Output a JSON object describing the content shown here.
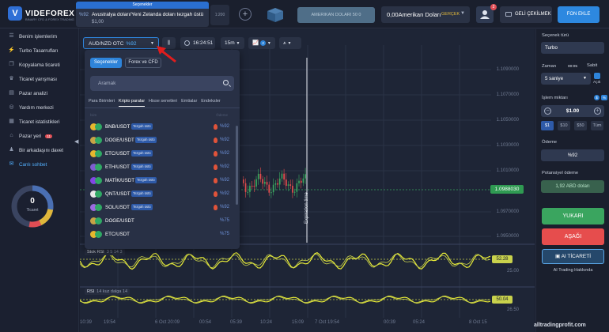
{
  "brand": {
    "name": "VIDEFOREX",
    "tagline": "BINARY CFD & FOREX TRADING"
  },
  "topbar": {
    "active_tab_header": "Seçenekler",
    "active_tab_pct": "%92",
    "active_tab_pair": "Avustralya doları/Yeni Zelanda doları tezgah üstü",
    "active_tab_amount": "$1,00",
    "second_tab": "1:200",
    "demo_button": "AMERIKAN DOLARI 50 0",
    "balance": "0,00Amerikan Doları",
    "account_type": "GERÇEK",
    "notification_count": "2",
    "withdraw": "GELİ ÇEKİLMEK",
    "deposit": "FON EKLE"
  },
  "sidebar": {
    "items": [
      {
        "label": "Benim işlemlerim",
        "icon": "clipboard-icon"
      },
      {
        "label": "Turbo Tasarrufları",
        "icon": "turbo-icon"
      },
      {
        "label": "Kopyalama ticareti",
        "icon": "copy-icon"
      },
      {
        "label": "Ticaret yarışması",
        "icon": "trophy-icon"
      },
      {
        "label": "Pazar analizi",
        "icon": "analysis-icon"
      },
      {
        "label": "Yardım merkezi",
        "icon": "help-icon"
      },
      {
        "label": "Ticaret istatistikleri",
        "icon": "stats-icon"
      },
      {
        "label": "Pazar yeri",
        "icon": "market-icon",
        "badge": "11"
      },
      {
        "label": "Bir arkadaşını davet",
        "icon": "invite-icon"
      },
      {
        "label": "Canlı sohbet",
        "icon": "chat-icon"
      }
    ],
    "trades_count": "0",
    "trades_label": "Ticaret"
  },
  "chart_toolbar": {
    "pair": "AUD/NZD OTC",
    "pair_pct": "%92",
    "time": "16:24:51",
    "timeframe": "15m",
    "indicator_count": "2"
  },
  "chart": {
    "price_levels": [
      "1.1090000",
      "1.1070000",
      "1.1050000",
      "1.1030000",
      "1.1010000",
      "1.0970000",
      "1.0950000"
    ],
    "current_price": "1.0988030",
    "expiration_label": "Expiration time",
    "stoch_title": "Stok RSI",
    "stoch_params": "3 5 14 3",
    "stoch_value": "52.28",
    "stoch_level": "25.00",
    "rsi_title": "RSI",
    "rsi_params": "14 kuz dalga 14",
    "rsi_value": "50.04",
    "rsi_level": "26.50",
    "time_labels": [
      "10:39",
      "19:54",
      "6 Oct 20:09",
      "00:54",
      "05:39",
      "10:24",
      "15:09",
      "7 Oct 19:54",
      "00:39",
      "05:24",
      "8 Oct 15"
    ]
  },
  "dropdown": {
    "segments": [
      "Seçenekler",
      "Forex ve CFD"
    ],
    "search_placeholder": "Aramak",
    "categories": [
      "Para Birimleri",
      "Kripto paralar",
      "Hisse senetleri",
      "Emtialar",
      "Endeksler"
    ],
    "list_head_left": "İsim",
    "list_head_right": "Ödeme",
    "assets": [
      {
        "name": "BNB/USDT",
        "badge": "Tezgah üstü",
        "pct": "%92",
        "hot": true,
        "color": "#e6b72e"
      },
      {
        "name": "DOGE/USDT",
        "badge": "Tezgah üstü",
        "pct": "%92",
        "hot": true,
        "color": "#c7a446"
      },
      {
        "name": "ETC/USDT",
        "badge": "Tezgah üstü",
        "pct": "%92",
        "hot": true,
        "color": "#e6b72e"
      },
      {
        "name": "ETH/USDT",
        "badge": "Tezgah üstü",
        "pct": "%92",
        "hot": true,
        "color": "#7f5fd0"
      },
      {
        "name": "MATİK/USDT",
        "badge": "Tezgah üstü",
        "pct": "%92",
        "hot": true,
        "color": "#8247e5"
      },
      {
        "name": "QNT/USDT",
        "badge": "Tezgah üstü",
        "pct": "%92",
        "hot": true,
        "color": "#e8e8e8"
      },
      {
        "name": "SOL/USDT",
        "badge": "Tezgah üstü",
        "pct": "%92",
        "hot": true,
        "color": "#9c6ce0"
      },
      {
        "name": "DOGE/USDT",
        "badge": "",
        "pct": "%75",
        "hot": false,
        "color": "#c7a446"
      },
      {
        "name": "ETC/USDT",
        "badge": "",
        "pct": "%75",
        "hot": false,
        "color": "#e6b72e"
      }
    ]
  },
  "right_panel": {
    "option_type_label": "Seçenek türü",
    "option_type": "Turbo",
    "time_label": "Zaman",
    "time_value": "00:05",
    "fixed_label": "Sabit",
    "open_label": "Açık",
    "expiry": "5 saniye",
    "amount_label": "İşlem miktarı",
    "pct_button": "%",
    "amount": "$1.00",
    "quick_amounts": [
      "$1",
      "$10",
      "$50",
      "Tüm"
    ],
    "payout_label": "Ödeme",
    "payout": "%92",
    "profit_label": "Potansiyel ödeme",
    "profit": "1,92 ABD doları",
    "up": "YUKARI",
    "down": "AŞAĞI",
    "ai_trading": "AI TİCARETİ",
    "ai_about": "AI Trading Hakkında"
  },
  "watermark": "alltradingprofit.com",
  "colors": {
    "accent": "#2e84da",
    "up": "#3aa55f",
    "down": "#e64d4d",
    "indicator": "#c9d24c"
  }
}
